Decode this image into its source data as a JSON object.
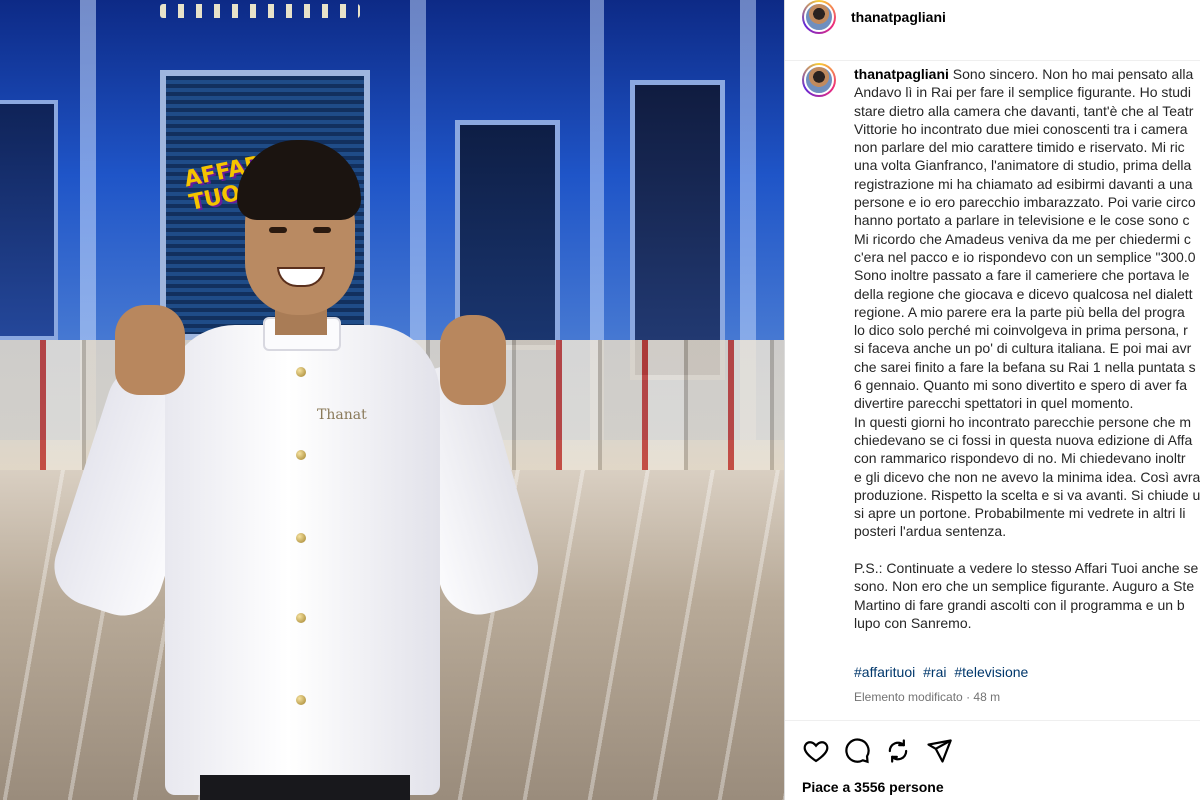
{
  "post": {
    "username": "thanatpagliani",
    "caption_lines": [
      "Sono sincero. Non ho mai pensato alla",
      "Andavo lì in Rai per fare il semplice figurante. Ho studi",
      "stare dietro alla camera che davanti, tant'è che al Teatr",
      "Vittorie ho incontrato due miei conoscenti tra i camera",
      "non parlare del mio carattere timido e riservato. Mi ric",
      "una volta Gianfranco, l'animatore di studio, prima della",
      "registrazione mi ha chiamato ad esibirmi davanti a una",
      "persone e io ero parecchio imbarazzato. Poi varie circo",
      "hanno portato a parlare in televisione e le cose sono c",
      "Mi ricordo che Amadeus veniva da me per chiedermi c",
      "c'era nel pacco e io rispondevo con un semplice \"300.0",
      "Sono inoltre passato a fare il cameriere che portava le",
      "della regione che giocava e dicevo qualcosa nel dialett",
      "regione. A mio parere era la parte più bella del progra",
      "lo dico solo perché mi coinvolgeva in prima persona, r",
      "si faceva anche un po' di cultura italiana. E poi mai avr",
      "che sarei finito a fare la befana su Rai 1 nella puntata s",
      "6 gennaio. Quanto mi sono divertito e spero di aver fa",
      "divertire parecchi spettatori in quel momento.",
      "In questi giorni ho incontrato parecchie persone che m",
      "chiedevano se ci fossi in questa nuova edizione di Affa",
      "con rammarico rispondevo di no. Mi chiedevano inoltr",
      "e gli dicevo che non ne avevo la minima idea. Così avra",
      "produzione. Rispetto la scelta e si va avanti. Si chiude u",
      "si apre un portone. Probabilmente mi vedrete in altri li",
      "posteri l'ardua sentenza.",
      "",
      "P.S.: Continuate a vedere lo stesso Affari Tuoi anche se",
      "sono. Non ero che un semplice figurante. Auguro a Ste",
      "Martino di fare grandi ascolti con il programma e un b",
      "lupo con Sanremo."
    ],
    "hashtags": [
      "#affarituoi",
      "#rai",
      "#televisione"
    ],
    "edited_label": "Elemento modificato",
    "time_ago": "48 m",
    "likes_text": "Piace a 3556 persone"
  },
  "photo": {
    "name_tag": "Thanat",
    "show_logo": "AFFARI TUOI"
  },
  "icons": {
    "like": "heart-icon",
    "comment": "comment-icon",
    "repost": "repost-icon",
    "share": "share-icon"
  }
}
